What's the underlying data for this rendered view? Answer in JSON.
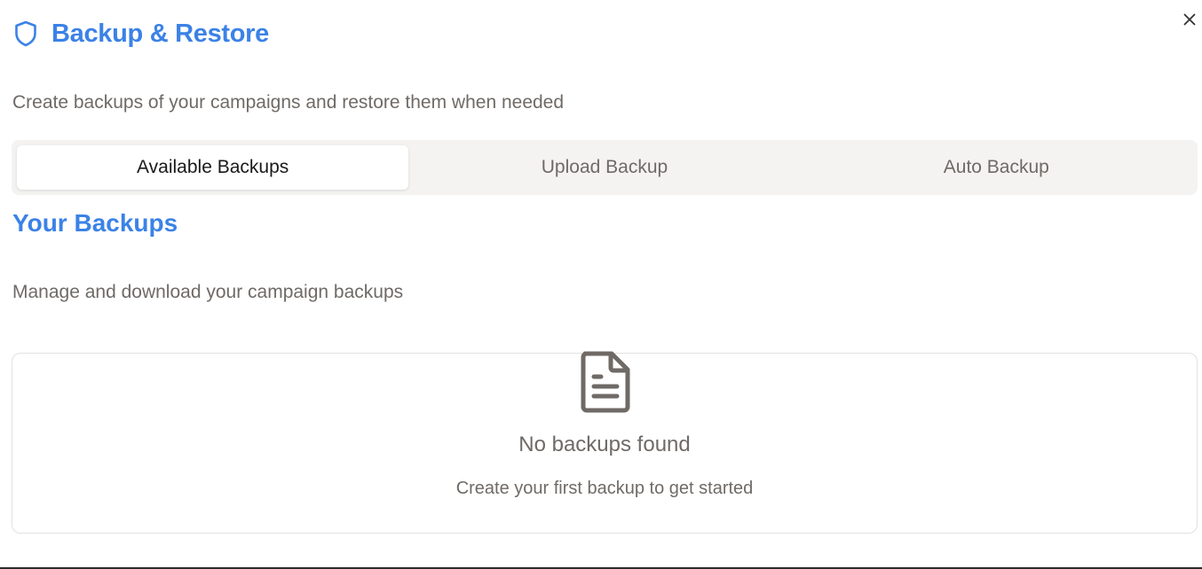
{
  "dialog": {
    "title": "Backup & Restore",
    "title_icon": "shield-icon",
    "close_icon": "close-icon",
    "subtitle": "Create backups of your campaigns and restore them when needed"
  },
  "tabs": [
    {
      "label": "Available Backups",
      "active": true
    },
    {
      "label": "Upload Backup",
      "active": false
    },
    {
      "label": "Auto Backup",
      "active": false
    }
  ],
  "section": {
    "title": "Your Backups",
    "subtitle": "Manage and download your campaign backups"
  },
  "empty_state": {
    "icon": "document-icon",
    "title": "No backups found",
    "message": "Create your first backup to get started"
  },
  "colors": {
    "accent": "#3b82e6",
    "muted_text": "#6f6a66",
    "tab_bg": "#f4f3f2"
  }
}
